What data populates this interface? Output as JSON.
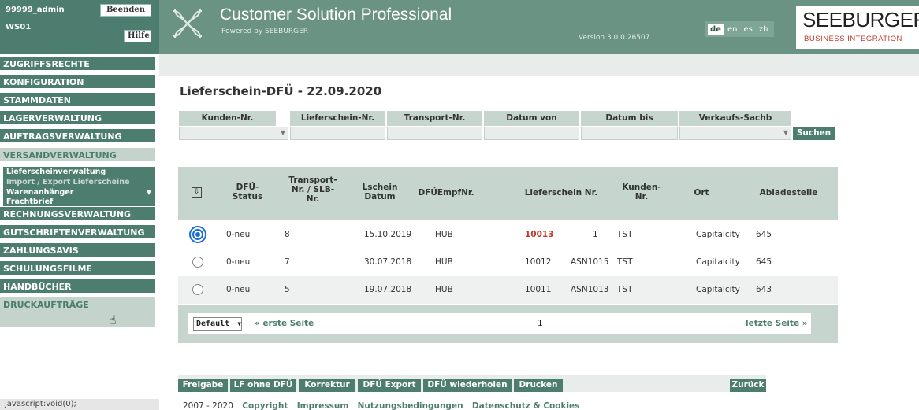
{
  "user": {
    "name": "99999_admin",
    "workstation": "WS01",
    "logout_label": "Beenden",
    "help_label": "Hilfe"
  },
  "nav": {
    "items": [
      {
        "label": "ZUGRIFFSRECHTE"
      },
      {
        "label": "KONFIGURATION"
      },
      {
        "label": "STAMMDATEN"
      },
      {
        "label": "LAGERVERWALTUNG"
      },
      {
        "label": "AUFTRAGSVERWALTUNG"
      },
      {
        "label": "VERSANDVERWALTUNG"
      },
      {
        "label": "RECHNUNGSVERWALTUNG"
      },
      {
        "label": "GUTSCHRIFTENVERWALTUNG"
      },
      {
        "label": "ZAHLUNGSAVIS"
      },
      {
        "label": "SCHULUNGSFILME"
      },
      {
        "label": "HANDBÜCHER"
      },
      {
        "label": "DRUCKAUFTRÄGE"
      }
    ],
    "sub_items": [
      {
        "label": "Lieferscheinverwaltung"
      },
      {
        "label": "Import / Export Lieferscheine"
      },
      {
        "label": "Warenanhänger"
      },
      {
        "label": "Frachtbrief"
      }
    ]
  },
  "status_text": "javascript:void(0);",
  "header": {
    "title": "Customer Solution Professional",
    "subtitle": "Powered by SEEBURGER",
    "version": "Version 3.0.0.26507",
    "languages": [
      "de",
      "en",
      "es",
      "zh"
    ],
    "active_language": "de",
    "brand_name": "SEEBURGER",
    "brand_tagline": "BUSINESS INTEGRATION",
    "brand_color": "#c0392b",
    "header_color": "#6b9383",
    "nav_color": "#4d7d6e"
  },
  "page": {
    "title": "Lieferschein-DFÜ - 22.09.2020"
  },
  "filter": {
    "headers": [
      "Kunden-Nr.",
      "Lieferschein-Nr.",
      "Transport-Nr.",
      "Datum von",
      "Datum bis",
      "Verkaufs-Sachb"
    ],
    "values": [
      "",
      "",
      "",
      "",
      "",
      ""
    ],
    "search_label": "Suchen"
  },
  "table": {
    "headers": [
      "DFÜ-\nStatus",
      "Transport-\nNr. / SLB-\nNr.",
      "Lschein\nDatum",
      "DFÜEmpfNr.",
      "Lieferschein Nr.",
      "Kunden-\nNr.",
      "Ort",
      "Abladestelle"
    ],
    "rows": [
      {
        "selected": true,
        "status": "0-neu",
        "transport": "8",
        "date": "15.10.2019",
        "empf": "HUB",
        "ls_nr": "10013",
        "ls_pos": "1",
        "kunde": "TST",
        "ort": "Capitalcity",
        "ablade": "645"
      },
      {
        "selected": false,
        "status": "0-neu",
        "transport": "7",
        "date": "30.07.2018",
        "empf": "HUB",
        "ls_nr": "10012",
        "ls_pos": "ASN1015",
        "kunde": "TST",
        "ort": "Capitalcity",
        "ablade": "645"
      },
      {
        "selected": false,
        "status": "0-neu",
        "transport": "5",
        "date": "19.07.2018",
        "empf": "HUB",
        "ls_nr": "10011",
        "ls_pos": "ASN1013",
        "kunde": "TST",
        "ort": "Capitalcity",
        "ablade": "643"
      }
    ]
  },
  "pager": {
    "page_size": "Default",
    "first_label": "« erste Seite",
    "current_page": "1",
    "last_label": "letzte Seite »"
  },
  "actions": {
    "freigabe": "Freigabe",
    "lf_ohne_dfue": "LF ohne DFÜ",
    "korrektur": "Korrektur",
    "dfue_export": "DFÜ Export",
    "dfue_wiederholen": "DFÜ wiederholen",
    "drucken": "Drucken",
    "zurueck": "Zurück"
  },
  "footer": {
    "years": "2007 - 2020",
    "links": [
      "Copyright",
      "Impressum",
      "Nutzungsbedingungen",
      "Datenschutz & Cookies"
    ]
  }
}
